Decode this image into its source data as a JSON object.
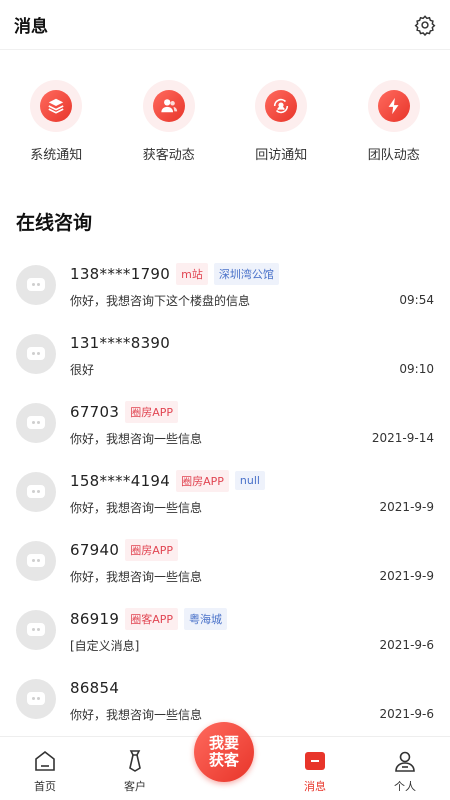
{
  "header": {
    "title": "消息"
  },
  "shortcuts": [
    {
      "label": "系统通知",
      "icon": "layers-icon"
    },
    {
      "label": "获客动态",
      "icon": "users-icon"
    },
    {
      "label": "回访通知",
      "icon": "refresh-user-icon"
    },
    {
      "label": "团队动态",
      "icon": "lightning-icon"
    }
  ],
  "section_title": "在线咨询",
  "conversations": [
    {
      "name": "138****1790",
      "tags": [
        "m站",
        "深圳湾公馆"
      ],
      "message": "你好，我想咨询下这个楼盘的信息",
      "time": "09:54"
    },
    {
      "name": "131****8390",
      "tags": [],
      "message": "很好",
      "time": "09:10"
    },
    {
      "name": "67703",
      "tags": [
        "圈房APP"
      ],
      "message": "你好，我想咨询一些信息",
      "time": "2021-9-14"
    },
    {
      "name": "158****4194",
      "tags": [
        "圈房APP",
        "null"
      ],
      "message": "你好，我想咨询一些信息",
      "time": "2021-9-9"
    },
    {
      "name": "67940",
      "tags": [
        "圈房APP"
      ],
      "message": "你好，我想咨询一些信息",
      "time": "2021-9-9"
    },
    {
      "name": "86919",
      "tags": [
        "圈客APP",
        "粤海城"
      ],
      "message": "[自定义消息]",
      "time": "2021-9-6"
    },
    {
      "name": "86854",
      "tags": [],
      "message": "你好，我想咨询一些信息",
      "time": "2021-9-6"
    }
  ],
  "tabbar": {
    "home": "首页",
    "clients": "客户",
    "fab_line1": "我要",
    "fab_line2": "获客",
    "messages": "消息",
    "profile": "个人"
  },
  "colors": {
    "accent": "#e8352a",
    "tag_red": "#e14552",
    "tag_blue": "#4a72c9"
  }
}
